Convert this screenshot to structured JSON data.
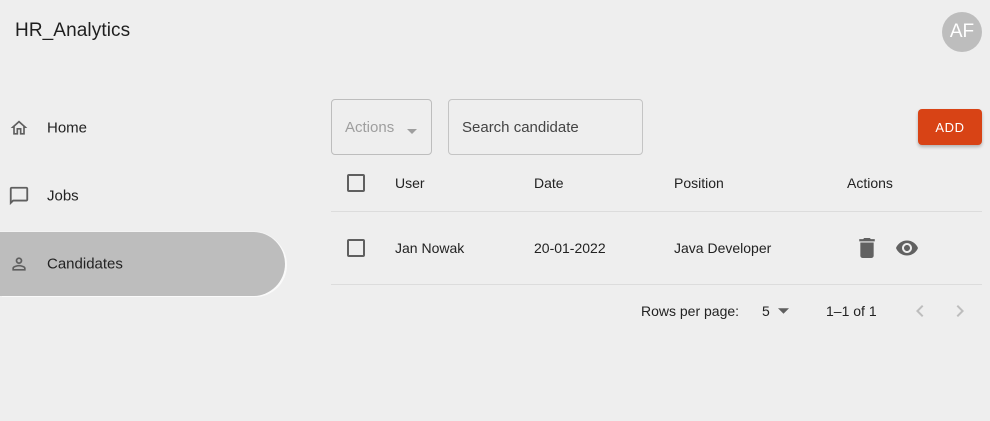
{
  "app": {
    "title": "HR_Analytics",
    "user_initials": "AF"
  },
  "sidebar": {
    "items": [
      {
        "label": "Home",
        "icon": "home-icon",
        "active": false
      },
      {
        "label": "Jobs",
        "icon": "chat-icon",
        "active": false
      },
      {
        "label": "Candidates",
        "icon": "person-icon",
        "active": true
      }
    ]
  },
  "toolbar": {
    "actions_label": "Actions",
    "search_placeholder": "Search candidate",
    "search_value": "",
    "add_label": "ADD"
  },
  "table": {
    "headers": {
      "user": "User",
      "date": "Date",
      "position": "Position",
      "actions": "Actions"
    },
    "rows": [
      {
        "user": "Jan Nowak",
        "date": "20-01-2022",
        "position": "Java Developer"
      }
    ]
  },
  "pagination": {
    "rows_per_page_label": "Rows per page:",
    "rows_per_page_value": "5",
    "range": "1–1 of 1"
  },
  "colors": {
    "background": "#eeeeee",
    "accent": "#d84315",
    "active_nav": "#bdbdbd",
    "avatar": "#bdbdbd"
  }
}
